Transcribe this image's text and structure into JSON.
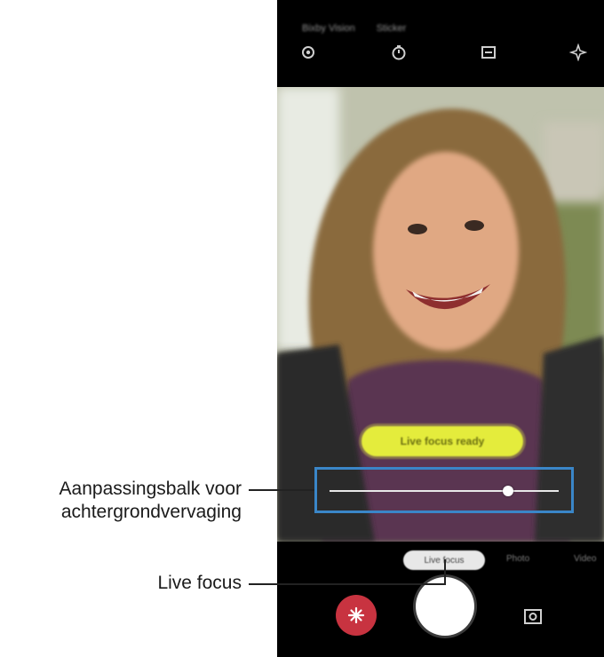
{
  "top_bar": {
    "modes": [
      "Bixby Vision",
      "Sticker"
    ],
    "icons": [
      "settings-icon",
      "timer-icon",
      "aspect-ratio-icon",
      "beauty-icon"
    ]
  },
  "viewfinder": {
    "live_focus_badge": "Live focus ready",
    "background_blur_level": 0.78
  },
  "bottom_bar": {
    "active_mode": "Live focus",
    "other_modes": [
      "Photo",
      "Video"
    ],
    "icons": [
      "effects-icon",
      "shutter-icon",
      "switch-camera-icon"
    ],
    "effects_color": "#c83340"
  },
  "callouts": {
    "blur_slider_line1": "Aanpassingsbalk voor",
    "blur_slider_line2": "achtergrondvervaging",
    "live_focus": "Live focus"
  },
  "colors": {
    "highlight_box": "#3a86c8",
    "badge": "#e4ec3c"
  }
}
